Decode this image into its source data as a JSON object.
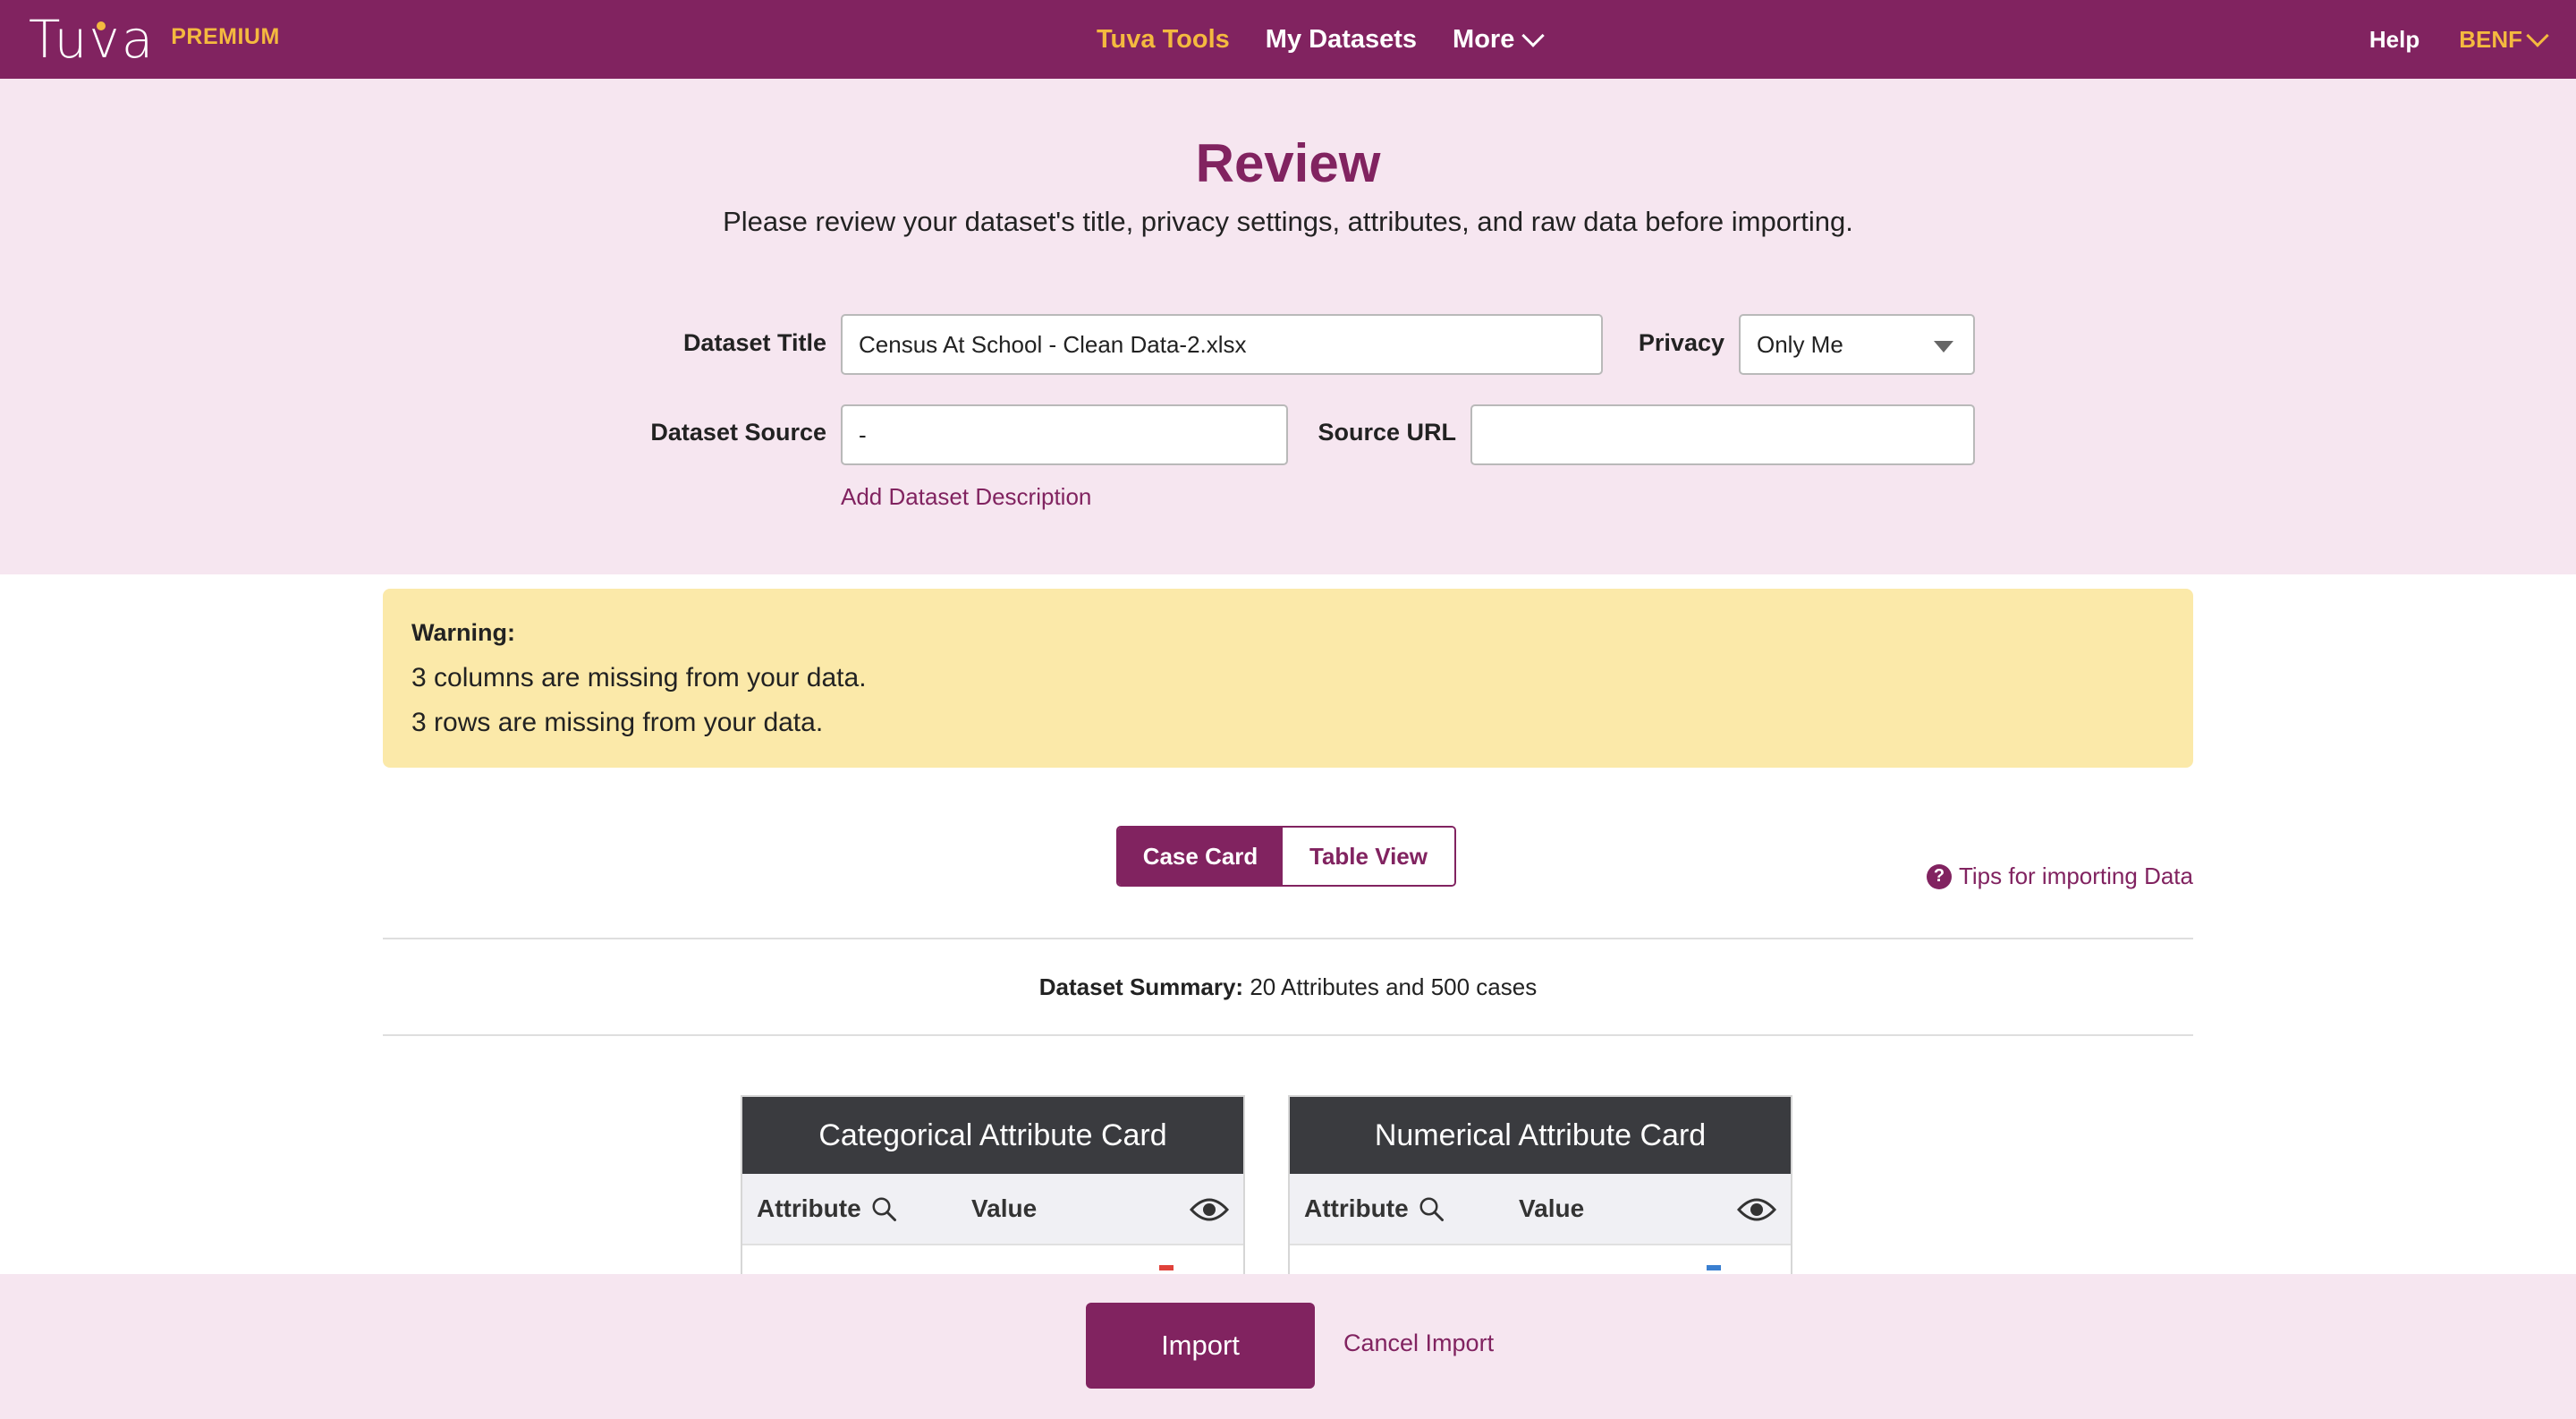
{
  "nav": {
    "logo_text": "Tuva",
    "premium": "PREMIUM",
    "links": [
      {
        "label": "Tuva Tools"
      },
      {
        "label": "My Datasets"
      },
      {
        "label": "More"
      }
    ],
    "help": "Help",
    "user": "BENF"
  },
  "review": {
    "title": "Review",
    "subtitle": "Please review your dataset's title, privacy settings, attributes, and raw data before importing."
  },
  "form": {
    "title_label": "Dataset Title",
    "title_value": "Census At School - Clean Data-2.xlsx",
    "privacy_label": "Privacy",
    "privacy_value": "Only Me",
    "source_label": "Dataset Source",
    "source_value": "-",
    "url_label": "Source URL",
    "url_value": "",
    "add_description": "Add Dataset Description"
  },
  "warning": {
    "title": "Warning:",
    "lines": [
      "3 columns are missing from your data.",
      "3 rows are missing from your data."
    ]
  },
  "view_toggle": {
    "case_card": "Case Card",
    "table_view": "Table View"
  },
  "tips": "Tips for importing Data",
  "summary": {
    "label": "Dataset Summary:",
    "text": "20 Attributes and 500 cases"
  },
  "cards": [
    {
      "title": "Categorical Attribute Card",
      "attr_col": "Attribute",
      "value_col": "Value",
      "accent": "#e0413a"
    },
    {
      "title": "Numerical Attribute Card",
      "attr_col": "Attribute",
      "value_col": "Value",
      "accent": "#3a7fd0"
    }
  ],
  "footer": {
    "import": "Import",
    "cancel": "Cancel Import"
  },
  "colors": {
    "brand": "#812360",
    "accent": "#f4b93f",
    "panel": "#f6e6f0",
    "warning_bg": "#fbe9a9"
  }
}
